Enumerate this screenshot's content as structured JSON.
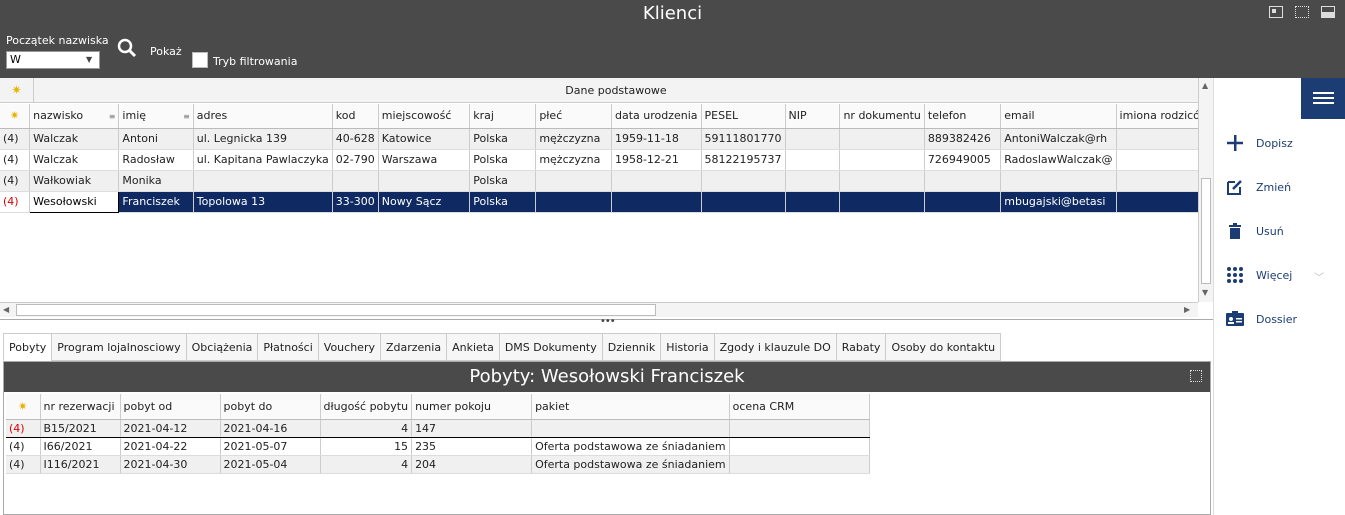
{
  "app": {
    "title": "Klienci"
  },
  "filter": {
    "label": "Początek nazwiska",
    "value": "W",
    "show_label": "Pokaż",
    "filter_mode_label": "Tryb filtrowania",
    "filter_mode_checked": false
  },
  "actions": {
    "add": "Dopisz",
    "edit": "Zmień",
    "delete": "Usuń",
    "more": "Więcej",
    "dossier": "Dossier"
  },
  "grid": {
    "band_title": "Dane podstawowe",
    "columns": [
      "nazwisko",
      "imię",
      "adres",
      "kod",
      "miejscowość",
      "kraj",
      "płeć",
      "data urodzenia",
      "PESEL",
      "NIP",
      "nr dokumentu",
      "telefon",
      "email",
      "imiona rodziców"
    ],
    "rows": [
      {
        "ind": "(4)",
        "cells": [
          "Walczak",
          "Antoni",
          "ul. Legnicka 139",
          "40-628",
          "Katowice",
          "Polska",
          "mężczyzna",
          "1959-11-18",
          "59111801770",
          "",
          "",
          "889382426",
          "AntoniWalczak@rh",
          ""
        ]
      },
      {
        "ind": "(4)",
        "cells": [
          "Walczak",
          "Radosław",
          "ul. Kapitana Pawlaczyka",
          "02-790",
          "Warszawa",
          "Polska",
          "mężczyzna",
          "1958-12-21",
          "58122195737",
          "",
          "",
          "726949005",
          "RadoslawWalczak@",
          ""
        ]
      },
      {
        "ind": "(4)",
        "cells": [
          "Wałkowiak",
          "Monika",
          "",
          "",
          "",
          "Polska",
          "",
          "",
          "",
          "",
          "",
          "",
          "",
          ""
        ]
      },
      {
        "ind": "(4)",
        "cells": [
          "Wesołowski",
          "Franciszek",
          "Topolowa 13",
          "33-300",
          "Nowy Sącz",
          "Polska",
          "",
          "",
          "",
          "",
          "",
          "",
          "mbugajski@betasi",
          ""
        ]
      }
    ]
  },
  "tabs": [
    "Pobyty",
    "Program lojalnosciowy",
    "Obciążenia",
    "Płatności",
    "Vouchery",
    "Zdarzenia",
    "Ankieta",
    "DMS Dokumenty",
    "Dziennik",
    "Historia",
    "Zgody i klauzule DO",
    "Rabaty",
    "Osoby do kontaktu"
  ],
  "detail": {
    "title": "Pobyty: Wesołowski Franciszek",
    "columns": [
      "nr rezerwacji",
      "pobyt od",
      "pobyt do",
      "długość pobytu",
      "numer pokoju",
      "pakiet",
      "ocena CRM"
    ],
    "rows": [
      {
        "ind": "(4)",
        "cells": [
          "B15/2021",
          "2021-04-12",
          "2021-04-16",
          "4",
          "147",
          "",
          ""
        ]
      },
      {
        "ind": "(4)",
        "cells": [
          "I66/2021",
          "2021-04-22",
          "2021-05-07",
          "15",
          "235",
          "Oferta podstawowa ze śniadaniem",
          ""
        ]
      },
      {
        "ind": "(4)",
        "cells": [
          "I116/2021",
          "2021-04-30",
          "2021-05-04",
          "4",
          "204",
          "Oferta podstawowa ze śniadaniem",
          ""
        ]
      }
    ]
  },
  "colors": {
    "titlebar": "#4a4a4a",
    "accent": "#1c3d73",
    "selection": "#0f2a63",
    "indicator_red": "#dd0000"
  }
}
